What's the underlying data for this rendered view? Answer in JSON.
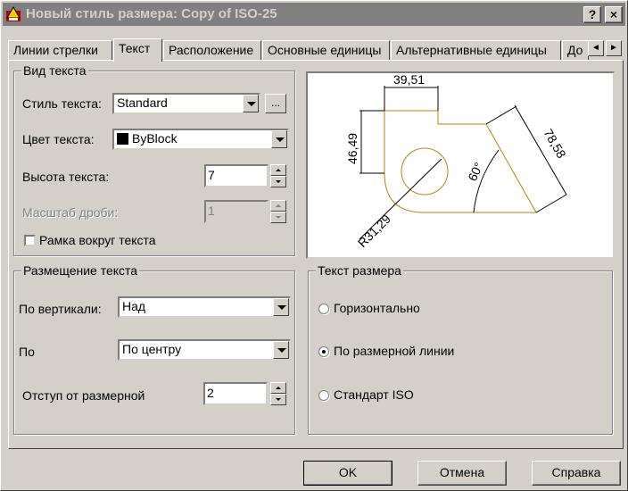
{
  "window": {
    "title": "Новый стиль размера: Copy of ISO-25",
    "help_label": "?",
    "close_label": "×"
  },
  "tabs": [
    {
      "label": "Линии стрелки",
      "active": false
    },
    {
      "label": "Текст",
      "active": true
    },
    {
      "label": "Расположение",
      "active": false
    },
    {
      "label": "Основные единицы",
      "active": false
    },
    {
      "label": "Альтернативные единицы",
      "active": false
    },
    {
      "label": "До",
      "active": false
    }
  ],
  "tab_scroll": {
    "left": "◄",
    "right": "►"
  },
  "text_appearance": {
    "title": "Вид текста",
    "style_label": "Стиль текста:",
    "style_value": "Standard",
    "style_button": "...",
    "color_label": "Цвет текста:",
    "color_value": "ByBlock",
    "color_swatch": "#000000",
    "height_label": "Высота текста:",
    "height_value": "7",
    "fraction_label": "Масштаб дроби:",
    "fraction_value": "1",
    "frame_label": "Рамка вокруг текста",
    "frame_checked": false
  },
  "text_placement": {
    "title": "Размещение текста",
    "vertical_label": "По вертикали:",
    "vertical_value": "Над",
    "horizontal_label": "По",
    "horizontal_value": "По центру",
    "offset_label": "Отступ от размерной",
    "offset_value": "2"
  },
  "text_alignment": {
    "title": "Текст размера",
    "options": [
      {
        "label": "Горизонтально",
        "checked": false
      },
      {
        "label": "По размерной линии",
        "checked": true
      },
      {
        "label": "Стандарт ISO",
        "checked": false
      }
    ]
  },
  "preview": {
    "dim_top": "39,51",
    "dim_left": "46,49",
    "dim_diag": "78,58",
    "dim_angle": "60°",
    "dim_radius": "R31,29",
    "line_color": "#b8860b"
  },
  "buttons": {
    "ok": "OK",
    "cancel": "Отмена",
    "help": "Справка"
  }
}
